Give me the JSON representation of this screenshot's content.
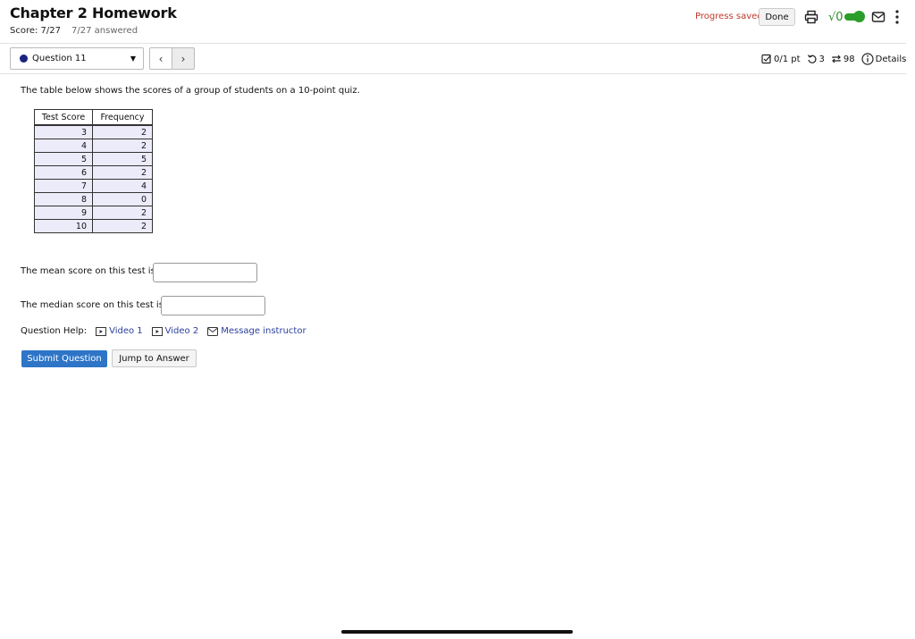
{
  "header": {
    "title": "Chapter 2 Homework",
    "score": "Score: 7/27",
    "answered": "7/27 answered",
    "progress": "Progress saved",
    "done_label": "Done",
    "sqrt_label": "√0"
  },
  "nav": {
    "question_label": "Question 11",
    "prev": "‹",
    "next": "›"
  },
  "meta": {
    "points": "0/1 pt",
    "retries": "3",
    "attempts": "98",
    "details": "Details"
  },
  "question": {
    "prompt": "The table below shows the scores of a group of students on a 10-point quiz.",
    "table": {
      "headers": [
        "Test Score",
        "Frequency"
      ],
      "rows": [
        [
          "3",
          "2"
        ],
        [
          "4",
          "2"
        ],
        [
          "5",
          "5"
        ],
        [
          "6",
          "2"
        ],
        [
          "7",
          "4"
        ],
        [
          "8",
          "0"
        ],
        [
          "9",
          "2"
        ],
        [
          "10",
          "2"
        ]
      ]
    },
    "mean_label": "The mean score on this test is:",
    "mean_value": "",
    "median_label": "The median score on this test is:",
    "median_value": ""
  },
  "help": {
    "label": "Question Help:",
    "video1": "Video 1",
    "video2": "Video 2",
    "message": "Message instructor"
  },
  "actions": {
    "submit": "Submit Question",
    "jump": "Jump to Answer"
  },
  "colors": {
    "accent": "#2e75c7",
    "progress": "#c0392b",
    "toggle": "#2a9d2a",
    "table_cell": "#ecebfa"
  }
}
